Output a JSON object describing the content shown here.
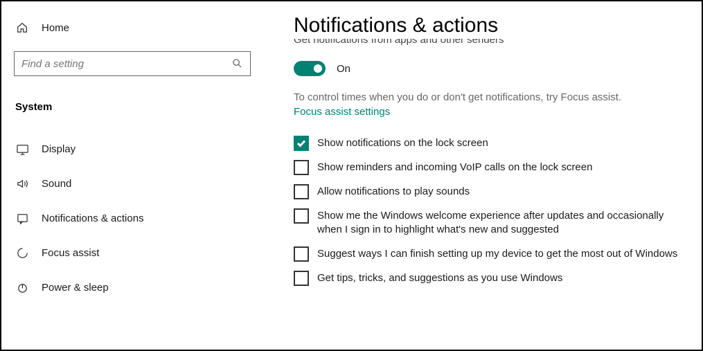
{
  "sidebar": {
    "home_label": "Home",
    "search_placeholder": "Find a setting",
    "category_label": "System",
    "items": [
      {
        "label": "Display",
        "icon": "display"
      },
      {
        "label": "Sound",
        "icon": "sound"
      },
      {
        "label": "Notifications & actions",
        "icon": "notifications"
      },
      {
        "label": "Focus assist",
        "icon": "focus"
      },
      {
        "label": "Power & sleep",
        "icon": "power"
      }
    ]
  },
  "main": {
    "title": "Notifications & actions",
    "subheading": "Get notifications from apps and other senders",
    "toggle": {
      "state": "On"
    },
    "helper_text": "To control times when you do or don't get notifications, try Focus assist.",
    "link_text": "Focus assist settings",
    "checks": [
      {
        "label": "Show notifications on the lock screen",
        "checked": true
      },
      {
        "label": "Show reminders and incoming VoIP calls on the lock screen",
        "checked": false
      },
      {
        "label": "Allow notifications to play sounds",
        "checked": false
      },
      {
        "label": "Show me the Windows welcome experience after updates and occasionally when I sign in to highlight what's new and suggested",
        "checked": false
      },
      {
        "label": "Suggest ways I can finish setting up my device to get the most out of Windows",
        "checked": false
      },
      {
        "label": "Get tips, tricks, and suggestions as you use Windows",
        "checked": false
      }
    ]
  },
  "colors": {
    "accent": "#008272"
  }
}
